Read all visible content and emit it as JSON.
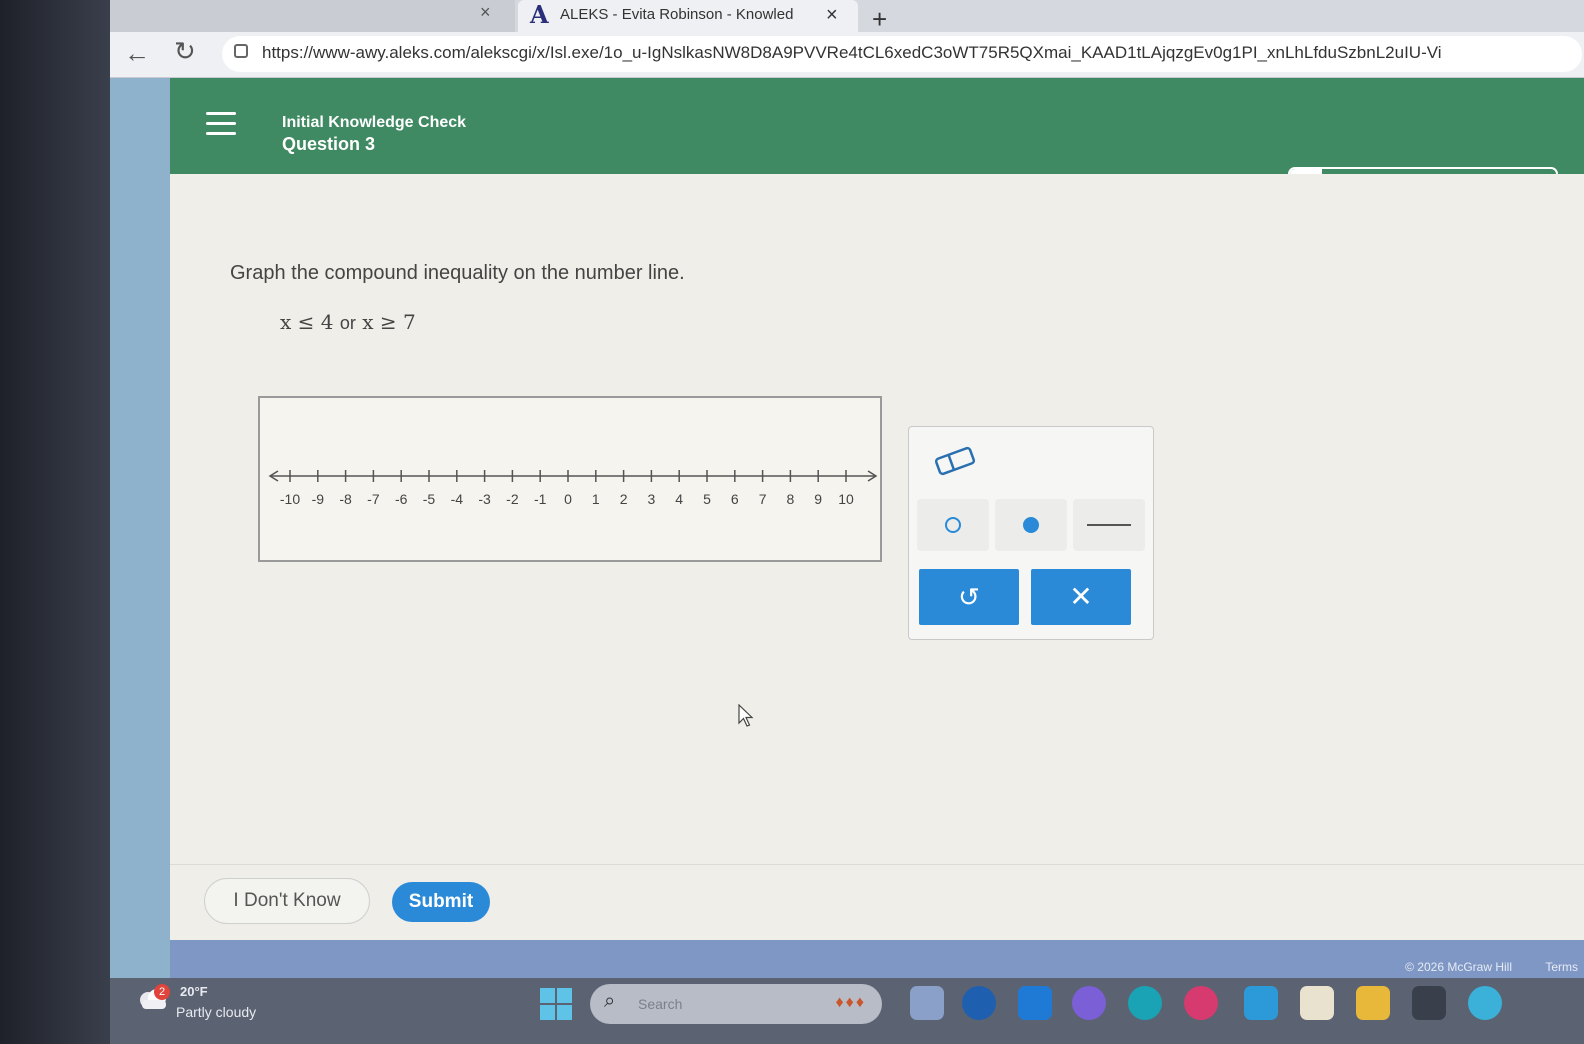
{
  "browser": {
    "prev_tab_close": "×",
    "active_tab": {
      "logo": "A",
      "title": "ALEKS - Evita Robinson - Knowled",
      "close": "×"
    },
    "new_tab": "+",
    "url": "https://www-awy.aleks.com/alekscgi/x/Isl.exe/1o_u-IgNslkasNW8D8A9PVVRe4tCL6xedC3oWT75R5QXmai_KAAD1tLAjqzgEv0g1PI_xnLhLfduSzbnL2uIU-Vi"
  },
  "header": {
    "title": "Initial Knowledge Check",
    "question": "Question 3",
    "progress": 0.12
  },
  "question": {
    "prompt": "Graph the compound inequality on the number line.",
    "expr_left": "x ≤ 4",
    "expr_or": "or",
    "expr_right": "x ≥ 7"
  },
  "number_line": {
    "min": -10,
    "max": 10,
    "tick_labels": [
      "-10",
      "-9",
      "-8",
      "-7",
      "-6",
      "-5",
      "-4",
      "-3",
      "-2",
      "-1",
      "0",
      "1",
      "2",
      "3",
      "4",
      "5",
      "6",
      "7",
      "8",
      "9",
      "10"
    ]
  },
  "tools": {
    "eraser_icon": "eraser-icon",
    "open_point_icon": "open-circle-icon",
    "closed_point_icon": "closed-circle-icon",
    "ray_icon": "ray-icon",
    "undo_label": "↺",
    "clear_label": "✕",
    "accent": "#2a8ad8"
  },
  "actions": {
    "dont_know": "I Don't Know",
    "submit": "Submit"
  },
  "footer": {
    "copyright": "© 2026 McGraw Hill",
    "terms": "Terms"
  },
  "taskbar": {
    "weather_badge": "2",
    "temperature": "20°F",
    "weather_desc": "Partly cloudy",
    "search_placeholder": "Search"
  },
  "colors": {
    "header_green": "#3f8a62",
    "button_blue": "#2a8ad8"
  }
}
